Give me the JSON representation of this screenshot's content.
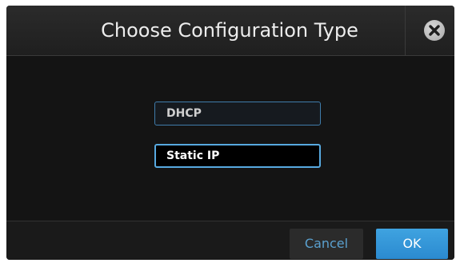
{
  "dialog": {
    "title": "Choose Configuration Type",
    "close_icon": "close-icon"
  },
  "options": [
    {
      "label": "DHCP",
      "selected": false
    },
    {
      "label": "Static IP",
      "selected": true
    }
  ],
  "footer": {
    "cancel_label": "Cancel",
    "ok_label": "OK"
  },
  "colors": {
    "accent": "#3fa3e0",
    "selected_border": "#57a9e0",
    "background": "#141414"
  }
}
